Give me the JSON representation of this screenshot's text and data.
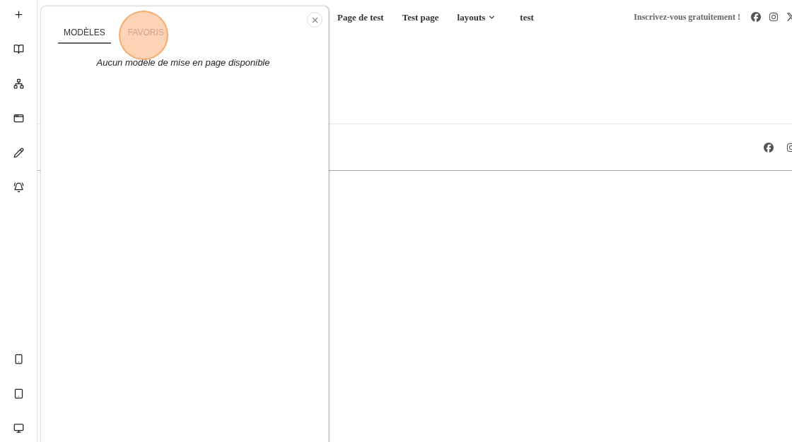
{
  "panel": {
    "tabs": [
      {
        "label": "MODÈLES",
        "selected": true
      },
      {
        "label": "FAVORIS",
        "selected": false
      }
    ],
    "message": "Aucun modèle de mise en page disponible"
  },
  "nav": {
    "links": [
      {
        "label": "Page de test",
        "kind": "link"
      },
      {
        "label": "Test page",
        "kind": "link"
      },
      {
        "label": "layouts",
        "kind": "dropdown"
      },
      {
        "label": "test",
        "kind": "link"
      }
    ],
    "signup": "Inscrivez-vous gratuitement !"
  }
}
